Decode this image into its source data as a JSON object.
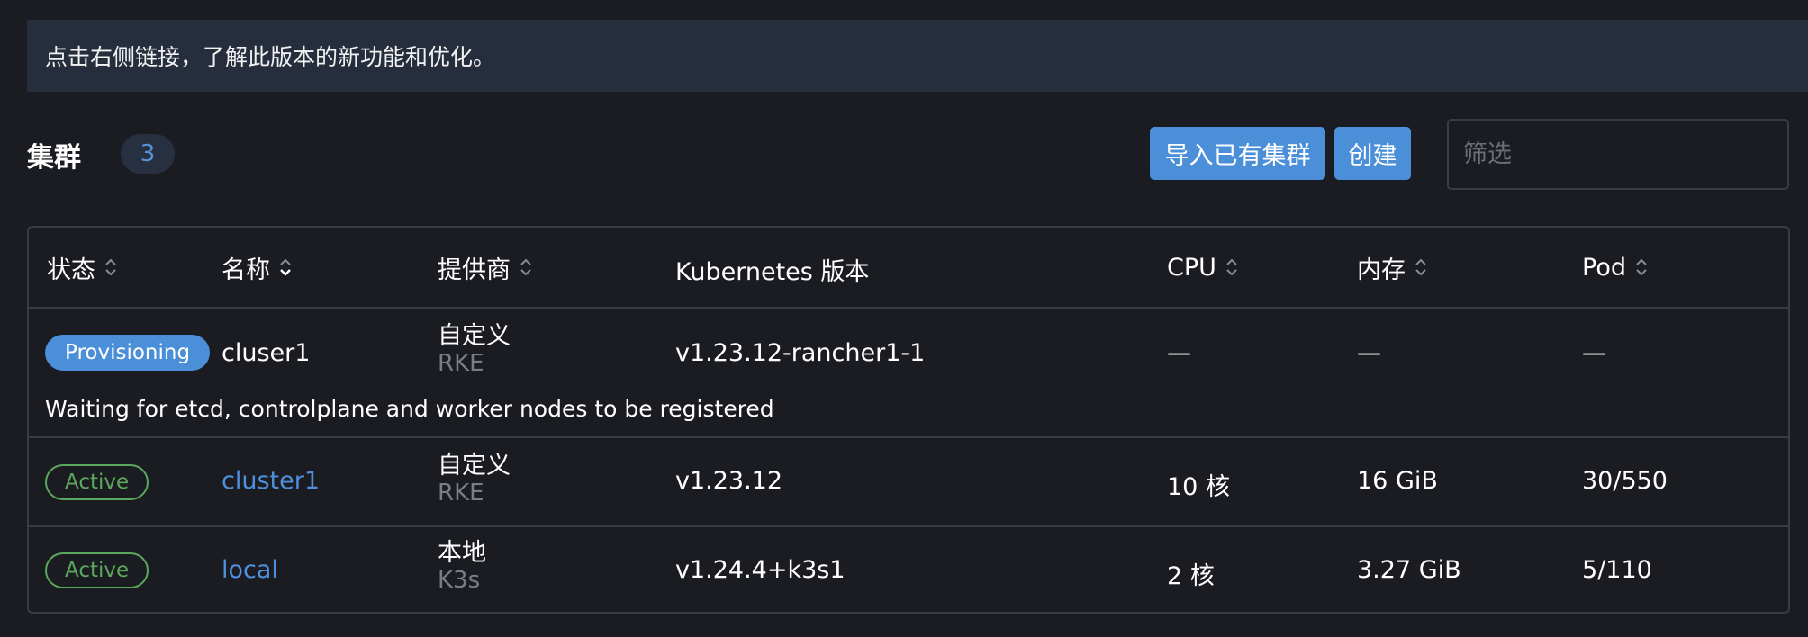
{
  "banner": {
    "text": "点击右侧链接，了解此版本的新功能和优化。"
  },
  "header": {
    "title": "集群",
    "count": "3",
    "import_button": "导入已有集群",
    "create_button": "创建",
    "filter_placeholder": "筛选"
  },
  "table": {
    "columns": {
      "status": "状态",
      "name": "名称",
      "provider": "提供商",
      "k8s_version": "Kubernetes 版本",
      "cpu": "CPU",
      "memory": "内存",
      "pod": "Pod"
    },
    "rows": [
      {
        "status": "Provisioning",
        "name": "cluser1",
        "provider": "自定义",
        "provider_sub": "RKE",
        "version": "v1.23.12-rancher1-1",
        "cpu": "—",
        "memory": "—",
        "pod": "—",
        "message": "Waiting for etcd, controlplane and worker nodes to be registered"
      },
      {
        "status": "Active",
        "name": "cluster1",
        "provider": "自定义",
        "provider_sub": "RKE",
        "version": "v1.23.12",
        "cpu": "10 核",
        "memory": "16 GiB",
        "pod": "30/550"
      },
      {
        "status": "Active",
        "name": "local",
        "provider": "本地",
        "provider_sub": "K3s",
        "version": "v1.24.4+k3s1",
        "cpu": "2 核",
        "memory": "3.27 GiB",
        "pod": "5/110"
      }
    ]
  },
  "colors": {
    "background": "#1b1c21",
    "banner": "#262e3d",
    "primary": "#4a8fd8",
    "link": "#4f8fdc",
    "active": "#5da65d",
    "border": "#3a3c44",
    "muted": "#7b7d84"
  }
}
